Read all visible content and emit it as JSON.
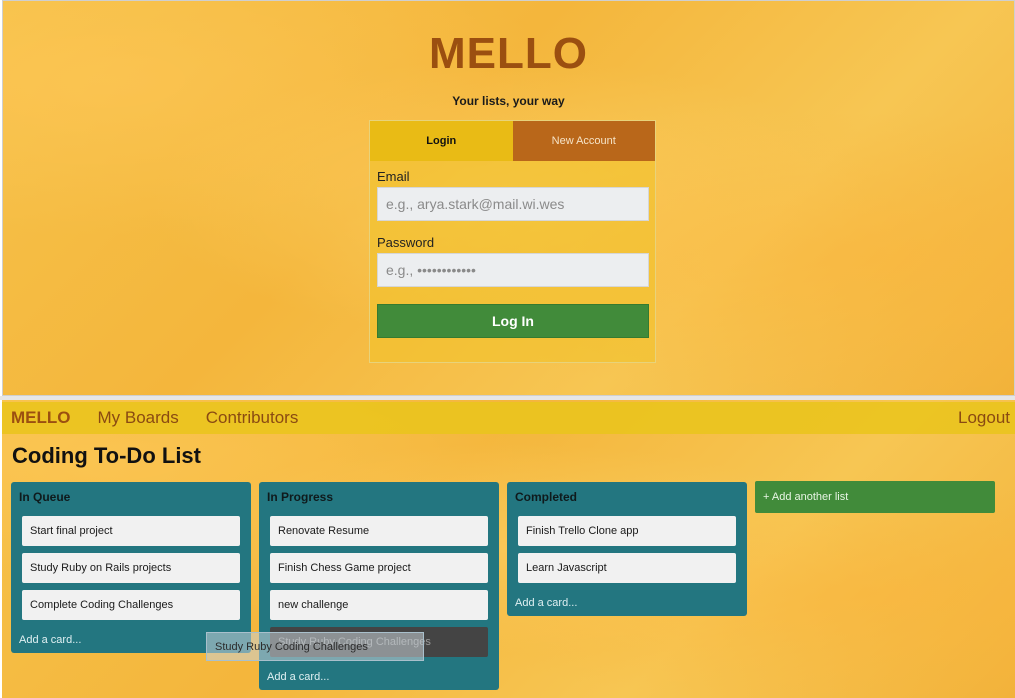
{
  "login": {
    "logo": "MELLO",
    "tagline": "Your lists, your way",
    "tabs": {
      "login": "Login",
      "new_account": "New Account"
    },
    "email_label": "Email",
    "email_placeholder": "e.g., arya.stark@mail.wi.wes",
    "password_label": "Password",
    "password_placeholder": "e.g., ••••••••••••",
    "submit_label": "Log In"
  },
  "navbar": {
    "logo": "MELLO",
    "links": [
      "My Boards",
      "Contributors"
    ],
    "logout": "Logout"
  },
  "board": {
    "title": "Coding To-Do List",
    "lists": [
      {
        "title": "In Queue",
        "cards": [
          "Start final project",
          "Study Ruby on Rails projects",
          "Complete Coding Challenges"
        ],
        "add_card": "Add a card..."
      },
      {
        "title": "In Progress",
        "cards": [
          "Renovate Resume",
          "Finish Chess Game project",
          "new challenge"
        ],
        "ghost_card": "Study Ruby Coding Challenges",
        "add_card": "Add a card..."
      },
      {
        "title": "Completed",
        "cards": [
          "Finish Trello Clone app",
          "Learn Javascript"
        ],
        "add_card": "Add a card..."
      }
    ],
    "add_list": "+ Add another list",
    "dragging_card": "Study Ruby Coding Challenges"
  },
  "colors": {
    "brand": "#9b4f10",
    "list_bg": "#237680",
    "primary_button": "#418b3a",
    "tab_active": "#e9bb15",
    "tab_inactive": "#b9671a"
  }
}
